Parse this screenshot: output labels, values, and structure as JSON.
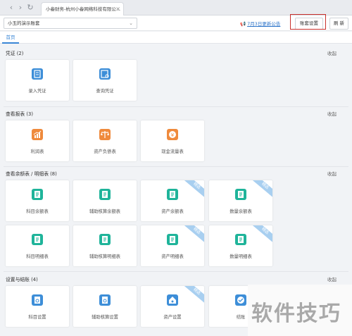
{
  "browser": {
    "back": "‹",
    "forward": "›",
    "reload": "↻",
    "tab_title": "小畚财务-杭州小畚网络科技有限公...",
    "tab_close": "×"
  },
  "appbar": {
    "account_name": "小玉的演示账套",
    "notice": "7月3日更新公告",
    "settings_button": "账套设置",
    "refresh_button": "刷 新"
  },
  "page_tabs": [
    "首页"
  ],
  "collapse_label": "收起",
  "sections": [
    {
      "title": "凭证 (2)",
      "cards": [
        {
          "label": "录入凭证",
          "icon": "voucher-entry-icon",
          "color": "#3d8ed8",
          "ribbon": ""
        },
        {
          "label": "查询凭证",
          "icon": "voucher-query-icon",
          "color": "#3d8ed8",
          "ribbon": ""
        }
      ]
    },
    {
      "title": "查看报表 (3)",
      "cards": [
        {
          "label": "利润表",
          "icon": "profit-chart-icon",
          "color": "#ef8a3c",
          "ribbon": ""
        },
        {
          "label": "资产负债表",
          "icon": "balance-scale-icon",
          "color": "#ef8a3c",
          "ribbon": ""
        },
        {
          "label": "现金流量表",
          "icon": "cash-flow-icon",
          "color": "#ef8a3c",
          "ribbon": ""
        }
      ]
    },
    {
      "title": "查看余额表 / 明细表 (8)",
      "cards": [
        {
          "label": "科目余额表",
          "icon": "ledger-icon",
          "color": "#1fb49a",
          "ribbon": ""
        },
        {
          "label": "辅助核算余额表",
          "icon": "ledger-icon",
          "color": "#1fb49a",
          "ribbon": ""
        },
        {
          "label": "资产余额表",
          "icon": "ledger-icon",
          "color": "#1fb49a",
          "ribbon": "精选"
        },
        {
          "label": "数量余额表",
          "icon": "ledger-icon",
          "color": "#1fb49a",
          "ribbon": "精选"
        },
        {
          "label": "科目明细表",
          "icon": "ledger-icon",
          "color": "#1fb49a",
          "ribbon": ""
        },
        {
          "label": "辅助核算明细表",
          "icon": "ledger-icon",
          "color": "#1fb49a",
          "ribbon": ""
        },
        {
          "label": "资产明细表",
          "icon": "ledger-icon",
          "color": "#1fb49a",
          "ribbon": "精选"
        },
        {
          "label": "数量明细表",
          "icon": "ledger-icon",
          "color": "#1fb49a",
          "ribbon": "精选"
        }
      ]
    },
    {
      "title": "设置与结账 (4)",
      "cards": [
        {
          "label": "科目设置",
          "icon": "settings-doc-icon",
          "color": "#3d8ed8",
          "ribbon": ""
        },
        {
          "label": "辅助核算设置",
          "icon": "settings-doc-icon",
          "color": "#3d8ed8",
          "ribbon": ""
        },
        {
          "label": "资产设置",
          "icon": "asset-settings-icon",
          "color": "#3d8ed8",
          "ribbon": "精选"
        },
        {
          "label": "结账",
          "icon": "closing-icon",
          "color": "#3d8ed8",
          "ribbon": ""
        }
      ]
    }
  ],
  "watermark": "软件技巧"
}
